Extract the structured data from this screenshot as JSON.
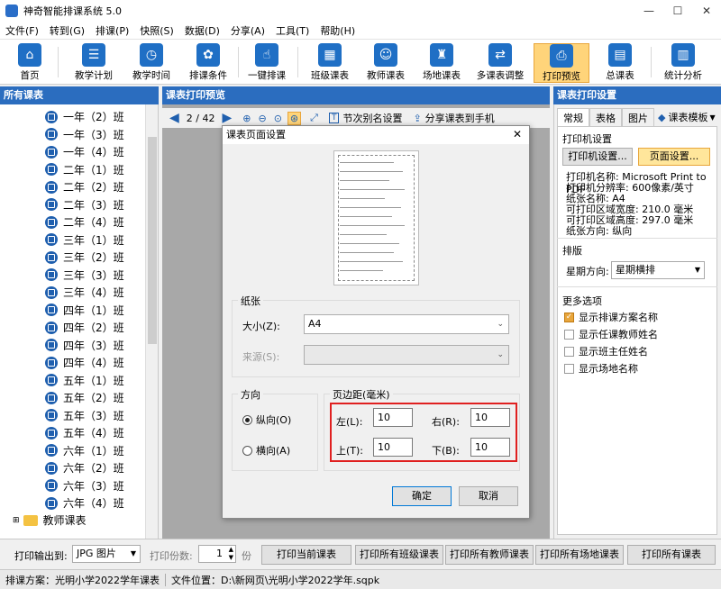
{
  "window": {
    "title": "神奇智能排课系统 5.0",
    "minimize": "—",
    "maximize": "☐",
    "close": "✕"
  },
  "menu": [
    "文件(F)",
    "转到(G)",
    "排课(P)",
    "快照(S)",
    "数据(D)",
    "分享(A)",
    "工具(T)",
    "帮助(H)"
  ],
  "toolbar": [
    {
      "label": "首页",
      "icon": "home-icon"
    },
    {
      "label": "教学计划",
      "icon": "plan-icon"
    },
    {
      "label": "教学时间",
      "icon": "clock-icon"
    },
    {
      "label": "排课条件",
      "icon": "conditions-icon"
    },
    {
      "label": "一键排课",
      "icon": "one-click-icon"
    },
    {
      "label": "班级课表",
      "icon": "class-schedule-icon"
    },
    {
      "label": "教师课表",
      "icon": "teacher-schedule-icon"
    },
    {
      "label": "场地课表",
      "icon": "venue-schedule-icon"
    },
    {
      "label": "多课表调整",
      "icon": "multi-adjust-icon"
    },
    {
      "label": "打印预览",
      "icon": "printer-icon"
    },
    {
      "label": "总课表",
      "icon": "master-schedule-icon"
    },
    {
      "label": "统计分析",
      "icon": "chart-icon"
    }
  ],
  "left": {
    "title": "所有课表",
    "classes": [
      "一年（2）班",
      "一年（3）班",
      "一年（4）班",
      "二年（1）班",
      "二年（2）班",
      "二年（3）班",
      "二年（4）班",
      "三年（1）班",
      "三年（2）班",
      "三年（3）班",
      "三年（4）班",
      "四年（1）班",
      "四年（2）班",
      "四年（3）班",
      "四年（4）班",
      "五年（1）班",
      "五年（2）班",
      "五年（3）班",
      "五年（4）班",
      "六年（1）班",
      "六年（2）班",
      "六年（3）班",
      "六年（4）班"
    ],
    "teacher_node": "教师课表"
  },
  "center": {
    "title": "课表打印预览",
    "page_indicator": "2 / 42",
    "alias_btn": "节次别名设置",
    "share_btn": "分享课表到手机"
  },
  "dialog": {
    "title": "课表页面设置",
    "paper_group": "纸张",
    "size_label": "大小(Z):",
    "size_value": "A4",
    "source_label": "来源(S):",
    "source_value": "",
    "orientation_group": "方向",
    "portrait": "纵向(O)",
    "landscape": "横向(A)",
    "margins_group": "页边距(毫米)",
    "left_label": "左(L):",
    "left_value": "10",
    "right_label": "右(R):",
    "right_value": "10",
    "top_label": "上(T):",
    "top_value": "10",
    "bottom_label": "下(B):",
    "bottom_value": "10",
    "ok": "确定",
    "cancel": "取消"
  },
  "right": {
    "title": "课表打印设置",
    "tabs": [
      "常规",
      "表格",
      "图片"
    ],
    "template_btn": "课表模板",
    "printer_group": "打印机设置",
    "printer_btn": "打印机设置...",
    "page_btn": "页面设置...",
    "info": [
      "打印机名称: Microsoft Print to PDF",
      "打印机分辨率: 600像素/英寸",
      "纸张名称: A4",
      "可打印区域宽度: 210.0 毫米",
      "可打印区域高度: 297.0 毫米",
      "纸张方向: 纵向"
    ],
    "layout_group": "排版",
    "weekday_label": "星期方向:",
    "weekday_value": "星期横排",
    "more_group": "更多选项",
    "options": [
      {
        "label": "显示排课方案名称",
        "checked": true
      },
      {
        "label": "显示任课教师姓名",
        "checked": false
      },
      {
        "label": "显示班主任姓名",
        "checked": false
      },
      {
        "label": "显示场地名称",
        "checked": false
      }
    ]
  },
  "bottom": {
    "output_label": "打印输出到:",
    "output_value": "JPG 图片",
    "copies_label": "打印份数:",
    "copies_value": "1",
    "copies_unit": "份",
    "buttons": [
      "打印当前课表",
      "打印所有班级课表",
      "打印所有教师课表",
      "打印所有场地课表",
      "打印所有课表"
    ]
  },
  "status": {
    "scheme": "排课方案：光明小学2022学年课表",
    "file": "文件位置：D:\\新网页\\光明小学2022学年.sqpk"
  }
}
